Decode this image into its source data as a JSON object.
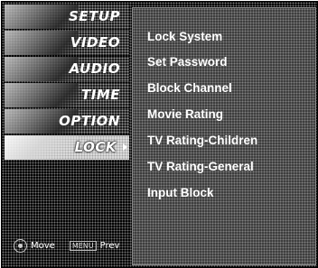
{
  "menu": {
    "items": [
      {
        "label": "SETUP",
        "icon": "setup-thumbnail-icon"
      },
      {
        "label": "VIDEO",
        "icon": "video-thumbnail-icon"
      },
      {
        "label": "AUDIO",
        "icon": "audio-thumbnail-icon"
      },
      {
        "label": "TIME",
        "icon": "time-thumbnail-icon"
      },
      {
        "label": "OPTION",
        "icon": "option-thumbnail-icon"
      },
      {
        "label": "LOCK",
        "icon": "lock-thumbnail-icon",
        "active": true
      }
    ],
    "footer": {
      "move_label": "Move",
      "prev_key": "MENU",
      "prev_label": "Prev"
    }
  },
  "lock_panel": {
    "options": [
      "Lock System",
      "Set Password",
      "Block Channel",
      "Movie Rating",
      "TV Rating-Children",
      "TV Rating-General",
      "Input Block"
    ]
  }
}
